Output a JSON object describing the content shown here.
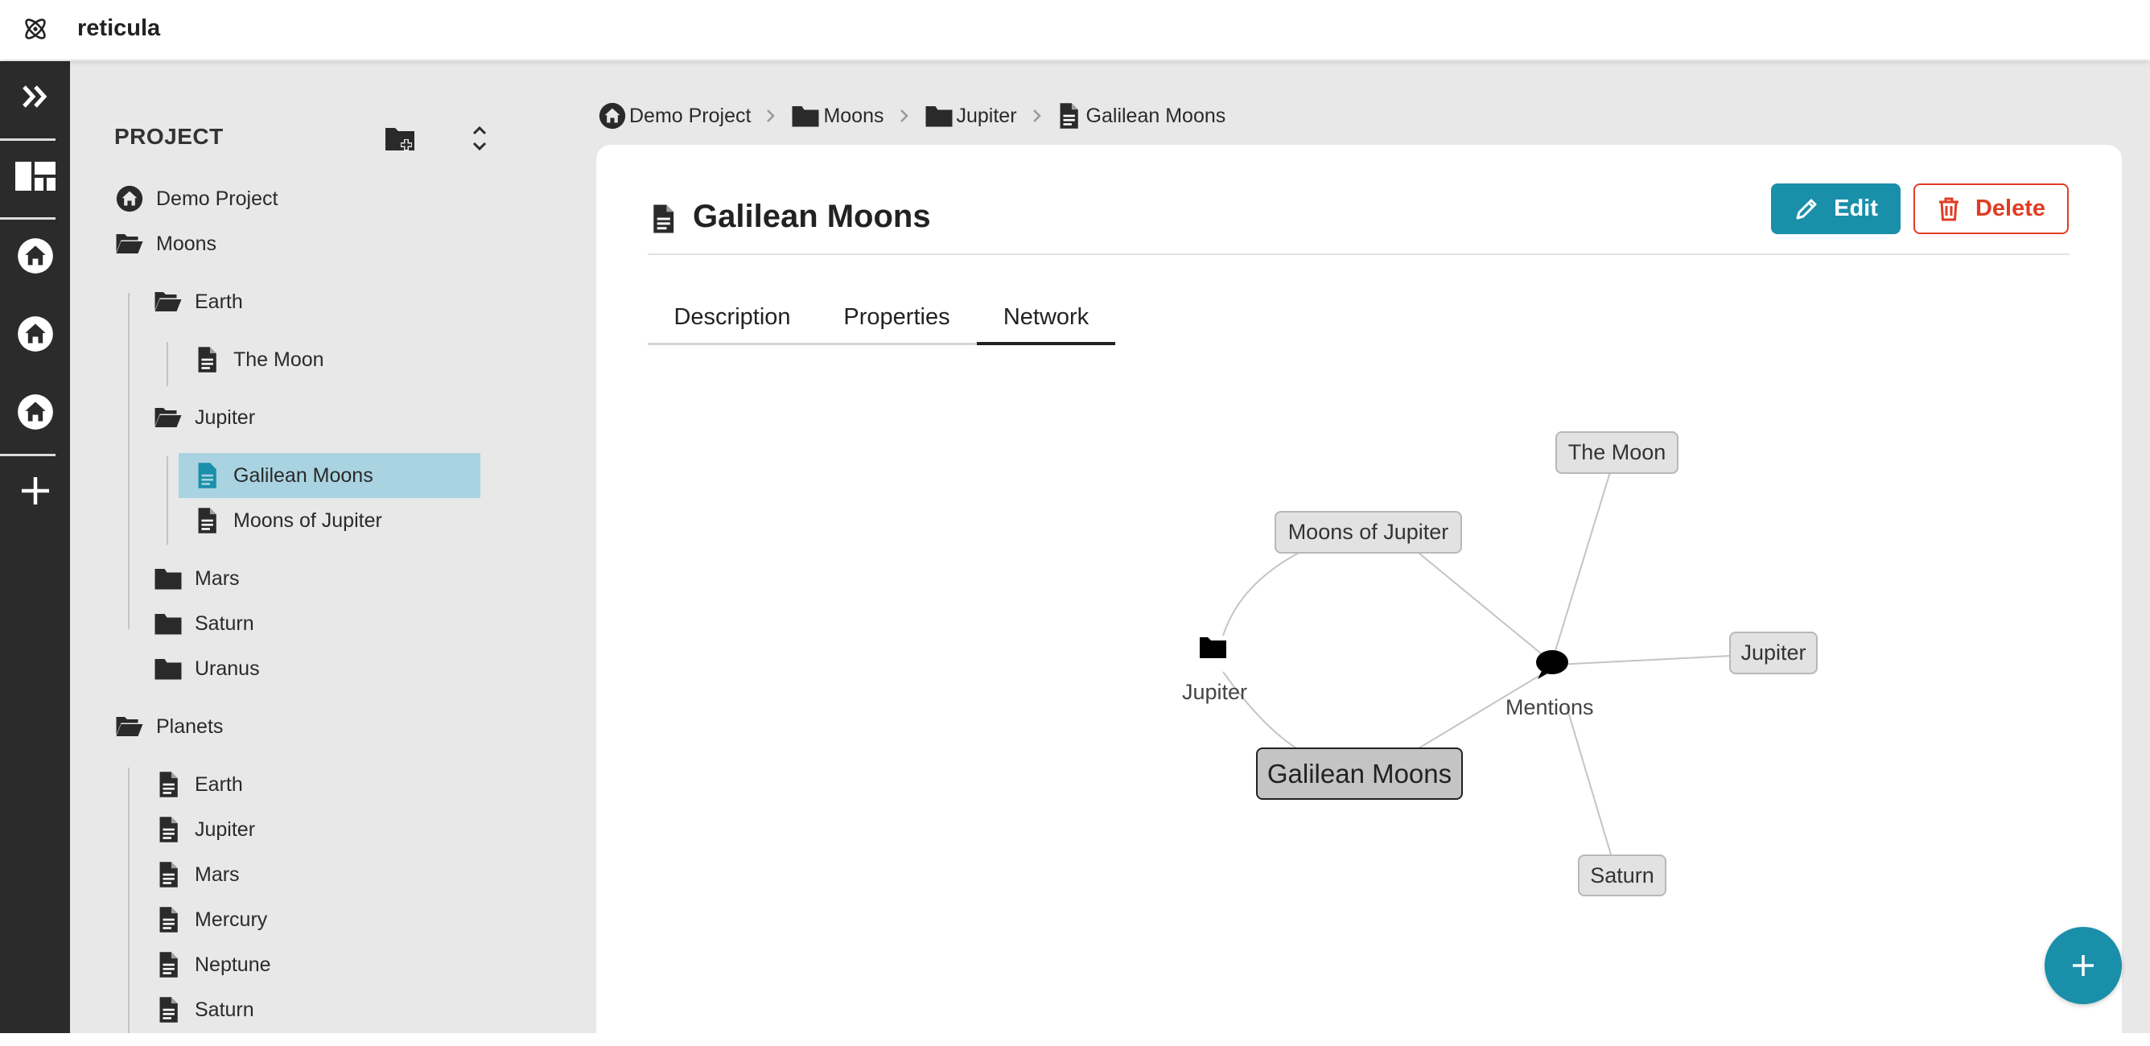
{
  "app": {
    "name": "reticula"
  },
  "sidebar_panel": {
    "title": "PROJECT",
    "tree": {
      "root": "Demo Project",
      "moons": "Moons",
      "moons_earth": "Earth",
      "the_moon": "The Moon",
      "moons_jupiter": "Jupiter",
      "galilean_moons": "Galilean Moons",
      "moons_of_jupiter": "Moons of Jupiter",
      "moons_mars": "Mars",
      "moons_saturn": "Saturn",
      "moons_uranus": "Uranus",
      "planets": "Planets",
      "planets_earth": "Earth",
      "planets_jupiter": "Jupiter",
      "planets_mars": "Mars",
      "planets_mercury": "Mercury",
      "planets_neptune": "Neptune",
      "planets_saturn": "Saturn"
    },
    "selected": "Galilean Moons"
  },
  "breadcrumb": [
    "Demo Project",
    "Moons",
    "Jupiter",
    "Galilean Moons"
  ],
  "document": {
    "title": "Galilean Moons",
    "edit_label": "Edit",
    "delete_label": "Delete"
  },
  "tabs": [
    "Description",
    "Properties",
    "Network"
  ],
  "active_tab": "Network",
  "network": {
    "nodes": {
      "center": "Galilean Moons",
      "moons_of_jupiter": "Moons of Jupiter",
      "the_moon": "The Moon",
      "jupiter_doc": "Jupiter",
      "saturn": "Saturn",
      "jupiter_folder": "Jupiter",
      "mentions": "Mentions"
    }
  },
  "colors": {
    "accent": "#1a8fa9",
    "danger": "#e03c23",
    "selected_row": "#a9d3e1",
    "rail": "#2b2b2b",
    "panel_bg": "#e8e8e8"
  },
  "icons": {
    "logo": "atom-icon",
    "rail": [
      "double-chevron-right-icon",
      "dashboard-icon",
      "home-icon",
      "home-icon",
      "home-icon",
      "plus-icon"
    ],
    "fab": "plus-icon"
  }
}
